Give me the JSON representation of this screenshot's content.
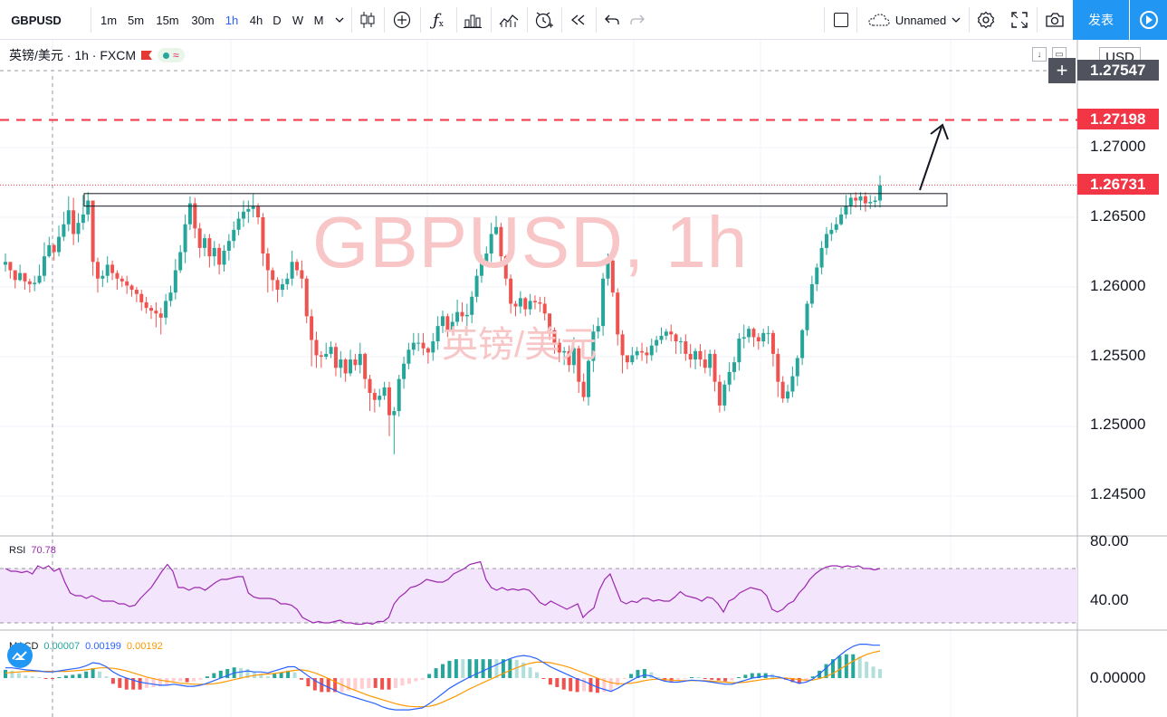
{
  "toolbar": {
    "symbol": "GBPUSD",
    "intervals": [
      "1m",
      "5m",
      "15m",
      "30m",
      "1h",
      "4h",
      "D",
      "W",
      "M"
    ],
    "active_interval": "1h",
    "icons": [
      "interval-dropdown-icon",
      "candle-style-icon",
      "compare-icon",
      "indicators-icon",
      "financials-icon",
      "templates-icon",
      "alert-icon",
      "replay-icon",
      "undo-icon",
      "redo-icon"
    ],
    "layout_name": "Unnamed",
    "publish_label": "发表"
  },
  "legend": {
    "title": "英镑/美元 · 1h · FXCM"
  },
  "price_axis": {
    "currency": "USD",
    "crosshair_price": "1.27547",
    "target_price": "1.27198",
    "last_price": "1.26731",
    "ticks": [
      "1.27000",
      "1.26500",
      "1.26000",
      "1.25500",
      "1.25000",
      "1.24500"
    ],
    "target_color": "#f23645",
    "last_color": "#f23645"
  },
  "watermark": {
    "main": "GBPUSD, 1h",
    "sub": "英镑/美元"
  },
  "rsi": {
    "label": "RSI",
    "value": "70.78",
    "ticks": [
      "80.00",
      "40.00"
    ],
    "color": "#9c27b0"
  },
  "macd": {
    "label": "MACD",
    "hist": "0.00007",
    "macd": "0.00199",
    "signal": "0.00192",
    "tick": "0.00000",
    "macd_color": "#2962ff",
    "signal_color": "#ff9800"
  },
  "chart_data": {
    "type": "candlestick",
    "closes": [
      1.2618,
      1.2612,
      1.2605,
      1.261,
      1.2604,
      1.2602,
      1.2603,
      1.2608,
      1.2622,
      1.263,
      1.2625,
      1.2636,
      1.2645,
      1.2655,
      1.2638,
      1.2646,
      1.2652,
      1.2662,
      1.2618,
      1.2606,
      1.2608,
      1.2616,
      1.261,
      1.2606,
      1.2604,
      1.2601,
      1.2598,
      1.2595,
      1.2589,
      1.2585,
      1.2583,
      1.2581,
      1.2578,
      1.259,
      1.2596,
      1.2612,
      1.2625,
      1.2645,
      1.266,
      1.2642,
      1.2628,
      1.2635,
      1.2622,
      1.2628,
      1.2616,
      1.2626,
      1.2633,
      1.2641,
      1.2649,
      1.2654,
      1.2656,
      1.2658,
      1.265,
      1.2624,
      1.2612,
      1.2605,
      1.2598,
      1.2602,
      1.2606,
      1.2618,
      1.2612,
      1.2606,
      1.2579,
      1.2562,
      1.2551,
      1.255,
      1.2552,
      1.2557,
      1.2542,
      1.2548,
      1.2538,
      1.2548,
      1.2544,
      1.2552,
      1.2534,
      1.2524,
      1.2519,
      1.2522,
      1.2528,
      1.2508,
      1.2511,
      1.2534,
      1.2545,
      1.2555,
      1.256,
      1.256,
      1.2556,
      1.2553,
      1.2561,
      1.2572,
      1.2579,
      1.2569,
      1.2575,
      1.2582,
      1.2579,
      1.258,
      1.2593,
      1.2608,
      1.2618,
      1.2624,
      1.2638,
      1.2643,
      1.2622,
      1.2606,
      1.2588,
      1.2586,
      1.2592,
      1.2584,
      1.259,
      1.2589,
      1.2588,
      1.2581,
      1.2569,
      1.256,
      1.2553,
      1.2554,
      1.2544,
      1.2556,
      1.2532,
      1.2521,
      1.2547,
      1.2568,
      1.2572,
      1.2606,
      1.2619,
      1.2596,
      1.2566,
      1.2551,
      1.2546,
      1.2551,
      1.2554,
      1.2553,
      1.2551,
      1.2558,
      1.2562,
      1.2565,
      1.2568,
      1.2566,
      1.2561,
      1.2561,
      1.2552,
      1.2548,
      1.2554,
      1.2548,
      1.2542,
      1.2552,
      1.2532,
      1.2515,
      1.253,
      1.2539,
      1.2546,
      1.2563,
      1.2564,
      1.257,
      1.2564,
      1.2561,
      1.2567,
      1.2567,
      1.2552,
      1.2532,
      1.252,
      1.2525,
      1.2536,
      1.2549,
      1.2569,
      1.2588,
      1.2602,
      1.2614,
      1.2628,
      1.2638,
      1.2641,
      1.2645,
      1.2652,
      1.2658,
      1.2664,
      1.2662,
      1.2665,
      1.266,
      1.2661,
      1.2662,
      1.2673
    ],
    "highs": [
      1.2624,
      1.2616,
      1.2611,
      1.2616,
      1.261,
      1.2606,
      1.2608,
      1.2616,
      1.2632,
      1.2636,
      1.2631,
      1.2644,
      1.2654,
      1.2665,
      1.2664,
      1.2653,
      1.2666,
      1.2668,
      1.2662,
      1.2621,
      1.2612,
      1.2622,
      1.2619,
      1.2612,
      1.2608,
      1.2608,
      1.2602,
      1.26,
      1.2598,
      1.2593,
      1.2587,
      1.2589,
      1.2585,
      1.2595,
      1.2601,
      1.262,
      1.263,
      1.2652,
      1.2665,
      1.2664,
      1.2646,
      1.2638,
      1.2638,
      1.2633,
      1.2631,
      1.263,
      1.2638,
      1.2647,
      1.2654,
      1.2662,
      1.2662,
      1.2667,
      1.266,
      1.2653,
      1.2628,
      1.2614,
      1.2607,
      1.2606,
      1.261,
      1.2626,
      1.262,
      1.2619,
      1.2608,
      1.2584,
      1.2568,
      1.2554,
      1.256,
      1.2561,
      1.256,
      1.2554,
      1.2549,
      1.2555,
      1.2552,
      1.256,
      1.2553,
      1.2537,
      1.2527,
      1.2527,
      1.2532,
      1.2532,
      1.2514,
      1.2537,
      1.255,
      1.256,
      1.2567,
      1.2567,
      1.2567,
      1.2557,
      1.2567,
      1.2579,
      1.2583,
      1.2581,
      1.2581,
      1.2591,
      1.2589,
      1.2588,
      1.2597,
      1.2613,
      1.2623,
      1.2629,
      1.2646,
      1.2651,
      1.2646,
      1.2623,
      1.2609,
      1.259,
      1.2597,
      1.2593,
      1.2595,
      1.2594,
      1.2593,
      1.2593,
      1.2581,
      1.2571,
      1.2563,
      1.2557,
      1.2558,
      1.2564,
      1.2558,
      1.2538,
      1.255,
      1.2573,
      1.2578,
      1.261,
      1.2624,
      1.2623,
      1.2599,
      1.2569,
      1.2549,
      1.2557,
      1.2557,
      1.256,
      1.2557,
      1.2563,
      1.2565,
      1.2571,
      1.257,
      1.2573,
      1.2567,
      1.2564,
      1.2566,
      1.2559,
      1.2556,
      1.2559,
      1.2555,
      1.2555,
      1.2555,
      1.2537,
      1.2533,
      1.2546,
      1.255,
      1.2567,
      1.2573,
      1.2572,
      1.2571,
      1.2567,
      1.257,
      1.2572,
      1.2569,
      1.2556,
      1.2536,
      1.253,
      1.2543,
      1.2551,
      1.257,
      1.259,
      1.2608,
      1.2617,
      1.2633,
      1.2643,
      1.2646,
      1.265,
      1.2657,
      1.2666,
      1.2667,
      1.2668,
      1.2668,
      1.2668,
      1.2666,
      1.2665,
      1.268
    ],
    "lows": [
      1.2611,
      1.2606,
      1.2599,
      1.2604,
      1.2598,
      1.2596,
      1.2597,
      1.2602,
      1.2604,
      1.2621,
      1.2619,
      1.2622,
      1.2633,
      1.264,
      1.263,
      1.2632,
      1.2641,
      1.2647,
      1.2608,
      1.2596,
      1.26,
      1.2603,
      1.2605,
      1.2598,
      1.26,
      1.2595,
      1.2593,
      1.2589,
      1.2583,
      1.2581,
      1.2577,
      1.2571,
      1.2566,
      1.2573,
      1.2586,
      1.2591,
      1.261,
      1.2617,
      1.2641,
      1.2635,
      1.2621,
      1.2622,
      1.2614,
      1.2615,
      1.2609,
      1.2611,
      1.2619,
      1.2628,
      1.2637,
      1.2643,
      1.2646,
      1.265,
      1.2645,
      1.2615,
      1.2596,
      1.2597,
      1.2589,
      1.2593,
      1.2598,
      1.2601,
      1.2608,
      1.2599,
      1.2574,
      1.2543,
      1.2542,
      1.2542,
      1.2548,
      1.2549,
      1.2536,
      1.2535,
      1.2532,
      1.2536,
      1.254,
      1.2538,
      1.2527,
      1.2511,
      1.251,
      1.2514,
      1.2519,
      1.2493,
      1.248,
      1.2507,
      1.2527,
      1.2541,
      1.2551,
      1.2554,
      1.2551,
      1.2545,
      1.2547,
      1.2555,
      1.2567,
      1.2564,
      1.2566,
      1.2572,
      1.2575,
      1.2572,
      1.2574,
      1.2589,
      1.2603,
      1.2616,
      1.2618,
      1.2637,
      1.2617,
      1.2601,
      1.2581,
      1.2579,
      1.2581,
      1.2579,
      1.258,
      1.2584,
      1.2582,
      1.2576,
      1.2562,
      1.2552,
      1.2546,
      1.2544,
      1.2539,
      1.2538,
      1.2524,
      1.2518,
      1.2515,
      1.2539,
      1.2563,
      1.2565,
      1.2601,
      1.2593,
      1.2558,
      1.2538,
      1.2541,
      1.2544,
      1.2548,
      1.2547,
      1.2545,
      1.2547,
      1.2553,
      1.2559,
      1.2562,
      1.2561,
      1.2552,
      1.2552,
      1.2547,
      1.2542,
      1.2541,
      1.2543,
      1.2538,
      1.2536,
      1.2525,
      1.251,
      1.2511,
      1.2525,
      1.2533,
      1.254,
      1.2556,
      1.256,
      1.2557,
      1.2555,
      1.2557,
      1.2559,
      1.2543,
      1.2521,
      1.2517,
      1.2517,
      1.2521,
      1.2529,
      1.2544,
      1.2565,
      1.2585,
      1.2597,
      1.2609,
      1.2623,
      1.2633,
      1.2639,
      1.2644,
      1.2649,
      1.2652,
      1.2657,
      1.2655,
      1.2654,
      1.2656,
      1.2657,
      1.2657
    ],
    "opens": [
      1.2616,
      1.2618,
      1.2612,
      1.2605,
      1.261,
      1.2604,
      1.2602,
      1.2603,
      1.2608,
      1.2622,
      1.263,
      1.2625,
      1.2636,
      1.2645,
      1.2655,
      1.2638,
      1.2646,
      1.2652,
      1.2662,
      1.2618,
      1.2606,
      1.2608,
      1.2616,
      1.261,
      1.2606,
      1.2604,
      1.2601,
      1.2598,
      1.2595,
      1.2589,
      1.2585,
      1.2583,
      1.2581,
      1.2578,
      1.259,
      1.2596,
      1.2612,
      1.2625,
      1.2645,
      1.266,
      1.2642,
      1.2628,
      1.2635,
      1.2622,
      1.2628,
      1.2616,
      1.2626,
      1.2633,
      1.2641,
      1.2649,
      1.2654,
      1.2656,
      1.2658,
      1.265,
      1.2624,
      1.2612,
      1.2605,
      1.2598,
      1.2602,
      1.2606,
      1.2618,
      1.2612,
      1.2606,
      1.2579,
      1.2562,
      1.2551,
      1.255,
      1.2552,
      1.2557,
      1.2542,
      1.2548,
      1.2538,
      1.2548,
      1.2544,
      1.2552,
      1.2534,
      1.2524,
      1.2519,
      1.2522,
      1.2528,
      1.2508,
      1.2511,
      1.2534,
      1.2545,
      1.2555,
      1.256,
      1.256,
      1.2556,
      1.2553,
      1.2561,
      1.2572,
      1.2579,
      1.2569,
      1.2575,
      1.2582,
      1.2579,
      1.258,
      1.2593,
      1.2608,
      1.2618,
      1.2624,
      1.2638,
      1.2643,
      1.2622,
      1.2606,
      1.2588,
      1.2586,
      1.2592,
      1.2584,
      1.259,
      1.2589,
      1.2588,
      1.2581,
      1.2569,
      1.256,
      1.2553,
      1.2554,
      1.2544,
      1.2556,
      1.2532,
      1.2521,
      1.2547,
      1.2568,
      1.2572,
      1.2606,
      1.2619,
      1.2596,
      1.2566,
      1.2551,
      1.2546,
      1.2551,
      1.2554,
      1.2553,
      1.2551,
      1.2558,
      1.2562,
      1.2565,
      1.2568,
      1.2566,
      1.2561,
      1.2561,
      1.2552,
      1.2548,
      1.2554,
      1.2548,
      1.2542,
      1.2552,
      1.2532,
      1.2515,
      1.253,
      1.2539,
      1.2546,
      1.2563,
      1.2564,
      1.257,
      1.2564,
      1.2561,
      1.2567,
      1.2567,
      1.2552,
      1.2532,
      1.252,
      1.2525,
      1.2536,
      1.2549,
      1.2569,
      1.2588,
      1.2602,
      1.2614,
      1.2628,
      1.2638,
      1.2641,
      1.2645,
      1.2652,
      1.2658,
      1.2664,
      1.2662,
      1.2665,
      1.266,
      1.2661,
      1.2662
    ],
    "target_level": 1.27198,
    "last_price": 1.26731,
    "resistance_zone": [
      1.2658,
      1.2667
    ],
    "rsi": [
      70,
      68,
      68,
      67,
      68,
      66,
      72,
      70,
      72,
      68,
      70,
      60,
      52,
      50,
      50,
      48,
      50,
      48,
      46,
      46,
      46,
      44,
      44,
      42,
      43,
      48,
      52,
      56,
      62,
      68,
      73,
      68,
      56,
      56,
      54,
      56,
      56,
      54,
      57,
      60,
      62,
      62,
      63,
      64,
      64,
      52,
      49,
      48,
      48,
      48,
      47,
      44,
      44,
      43,
      40,
      34,
      32,
      30,
      31,
      30,
      30,
      31,
      32,
      30,
      30,
      29,
      29,
      30,
      29,
      31,
      31,
      34,
      44,
      49,
      52,
      56,
      57,
      59,
      62,
      61,
      60,
      60,
      62,
      66,
      68,
      70,
      73,
      74,
      75,
      62,
      56,
      54,
      56,
      54,
      55,
      54,
      55,
      54,
      50,
      45,
      43,
      46,
      44,
      42,
      40,
      42,
      44,
      34,
      38,
      41,
      54,
      62,
      66,
      56,
      46,
      44,
      46,
      45,
      48,
      48,
      46,
      47,
      46,
      46,
      49,
      53,
      50,
      49,
      48,
      46,
      49,
      48,
      44,
      38,
      46,
      48,
      52,
      54,
      56,
      55,
      54,
      50,
      40,
      38,
      40,
      44,
      46,
      52,
      56,
      62,
      66,
      69,
      71,
      72,
      72,
      71,
      72,
      71,
      72,
      70,
      70,
      69,
      70
    ],
    "macd_line": [
      0.0002,
      0.0002,
      0.00018,
      0.00016,
      0.00015,
      0.00014,
      0.00012,
      0.00012,
      0.00014,
      0.00016,
      0.00018,
      0.0002,
      0.00024,
      0.0003,
      0.00028,
      0.00022,
      0.00012,
      5e-05,
      0.0,
      -4e-05,
      -8e-05,
      -0.0001,
      -0.00012,
      -0.00014,
      -0.00014,
      -0.00012,
      -0.00014,
      -0.00016,
      -0.00016,
      -0.00014,
      -0.0001,
      -5e-05,
      0.0,
      5e-05,
      0.0001,
      0.00012,
      0.00014,
      0.00012,
      0.00012,
      0.0001,
      0.00014,
      0.00018,
      0.00022,
      0.00022,
      0.00014,
      4e-05,
      -5e-05,
      -0.00012,
      -0.00018,
      -0.00024,
      -0.0003,
      -0.00034,
      -0.00038,
      -0.00042,
      -0.00046,
      -0.0005,
      -0.00056,
      -0.0006,
      -0.00062,
      -0.00062,
      -0.00062,
      -0.0006,
      -0.00058,
      -0.0005,
      -0.0004,
      -0.0003,
      -0.0002,
      -0.00012,
      -5e-05,
      2e-05,
      8e-05,
      0.00014,
      0.0002,
      0.00026,
      0.00032,
      0.00038,
      0.00042,
      0.00044,
      0.00042,
      0.00038,
      0.0003,
      0.00022,
      0.00016,
      0.0001,
      4e-05,
      -2e-05,
      -6e-05,
      -0.00012,
      -0.00018,
      -0.00022,
      -0.00026,
      -0.0002,
      -0.00012,
      -5e-05,
      2e-05,
      6e-05,
      4e-05,
      -2e-05,
      -6e-05,
      -8e-05,
      -8e-05,
      -6e-05,
      -4e-05,
      -5e-05,
      -6e-05,
      -8e-05,
      -0.0001,
      -0.00012,
      -0.00012,
      -8e-05,
      -4e-05,
      0.0,
      2e-05,
      4e-05,
      4e-05,
      2e-05,
      -2e-05,
      -6e-05,
      -0.0001,
      -8e-05,
      -2e-05,
      8e-05,
      0.0002,
      0.00032,
      0.00044,
      0.00054,
      0.00062,
      0.00066,
      0.00066,
      0.00064,
      0.00064
    ],
    "signal_line": [
      0.0001,
      0.00011,
      0.00012,
      0.00013,
      0.00013,
      0.00013,
      0.00013,
      0.00013,
      0.00013,
      0.00013,
      0.00014,
      0.00015,
      0.00016,
      0.00018,
      0.0002,
      0.0002,
      0.00019,
      0.00017,
      0.00014,
      0.0001,
      6e-05,
      2e-05,
      -1e-05,
      -4e-05,
      -6e-05,
      -8e-05,
      -0.0001,
      -0.00011,
      -0.00012,
      -0.00012,
      -0.00012,
      -0.00011,
      -9e-05,
      -6e-05,
      -3e-05,
      0.0,
      3e-05,
      5e-05,
      7e-05,
      8e-05,
      9e-05,
      0.00011,
      0.00013,
      0.00015,
      0.00016,
      0.00014,
      0.0001,
      5e-05,
      -1e-05,
      -7e-05,
      -0.00013,
      -0.00019,
      -0.00024,
      -0.00029,
      -0.00034,
      -0.00038,
      -0.00042,
      -0.00046,
      -0.0005,
      -0.00053,
      -0.00055,
      -0.00056,
      -0.00056,
      -0.00055,
      -0.00052,
      -0.00047,
      -0.00041,
      -0.00035,
      -0.00028,
      -0.00021,
      -0.00015,
      -9e-05,
      -3e-05,
      3e-05,
      9e-05,
      0.00015,
      0.0002,
      0.00025,
      0.00029,
      0.00031,
      0.00031,
      0.0003,
      0.00027,
      0.00024,
      0.0002,
      0.00015,
      0.0001,
      5e-05,
      0.0,
      -5e-05,
      -9e-05,
      -0.00011,
      -0.00011,
      -0.0001,
      -8e-05,
      -5e-05,
      -3e-05,
      -2e-05,
      -3e-05,
      -4e-05,
      -5e-05,
      -5e-05,
      -5e-05,
      -5e-05,
      -5e-05,
      -6e-05,
      -7e-05,
      -8e-05,
      -9e-05,
      -9e-05,
      -8e-05,
      -6e-05,
      -4e-05,
      -2e-05,
      -1e-05,
      -0.0,
      -0.0,
      -1e-05,
      -3e-05,
      -4e-05,
      -4e-05,
      -1e-05,
      3e-05,
      9e-05,
      0.00017,
      0.00025,
      0.00033,
      0.0004,
      0.00046,
      0.0005,
      0.00053
    ]
  }
}
